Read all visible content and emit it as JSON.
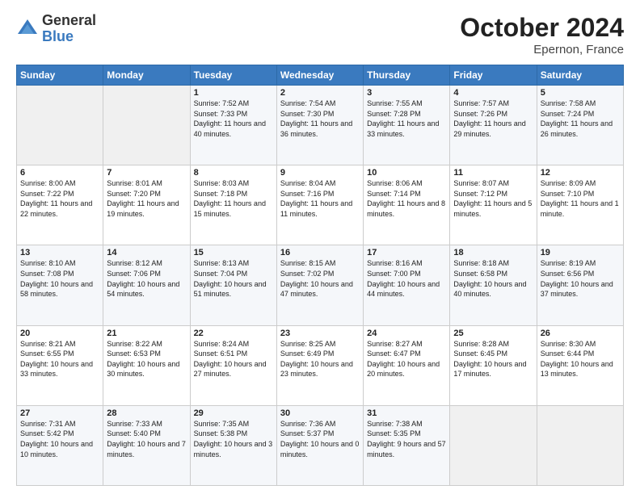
{
  "logo": {
    "general": "General",
    "blue": "Blue"
  },
  "header": {
    "month": "October 2024",
    "location": "Epernon, France"
  },
  "weekdays": [
    "Sunday",
    "Monday",
    "Tuesday",
    "Wednesday",
    "Thursday",
    "Friday",
    "Saturday"
  ],
  "weeks": [
    [
      {
        "day": "",
        "sunrise": "",
        "sunset": "",
        "daylight": ""
      },
      {
        "day": "",
        "sunrise": "",
        "sunset": "",
        "daylight": ""
      },
      {
        "day": "1",
        "sunrise": "Sunrise: 7:52 AM",
        "sunset": "Sunset: 7:33 PM",
        "daylight": "Daylight: 11 hours and 40 minutes."
      },
      {
        "day": "2",
        "sunrise": "Sunrise: 7:54 AM",
        "sunset": "Sunset: 7:30 PM",
        "daylight": "Daylight: 11 hours and 36 minutes."
      },
      {
        "day": "3",
        "sunrise": "Sunrise: 7:55 AM",
        "sunset": "Sunset: 7:28 PM",
        "daylight": "Daylight: 11 hours and 33 minutes."
      },
      {
        "day": "4",
        "sunrise": "Sunrise: 7:57 AM",
        "sunset": "Sunset: 7:26 PM",
        "daylight": "Daylight: 11 hours and 29 minutes."
      },
      {
        "day": "5",
        "sunrise": "Sunrise: 7:58 AM",
        "sunset": "Sunset: 7:24 PM",
        "daylight": "Daylight: 11 hours and 26 minutes."
      }
    ],
    [
      {
        "day": "6",
        "sunrise": "Sunrise: 8:00 AM",
        "sunset": "Sunset: 7:22 PM",
        "daylight": "Daylight: 11 hours and 22 minutes."
      },
      {
        "day": "7",
        "sunrise": "Sunrise: 8:01 AM",
        "sunset": "Sunset: 7:20 PM",
        "daylight": "Daylight: 11 hours and 19 minutes."
      },
      {
        "day": "8",
        "sunrise": "Sunrise: 8:03 AM",
        "sunset": "Sunset: 7:18 PM",
        "daylight": "Daylight: 11 hours and 15 minutes."
      },
      {
        "day": "9",
        "sunrise": "Sunrise: 8:04 AM",
        "sunset": "Sunset: 7:16 PM",
        "daylight": "Daylight: 11 hours and 11 minutes."
      },
      {
        "day": "10",
        "sunrise": "Sunrise: 8:06 AM",
        "sunset": "Sunset: 7:14 PM",
        "daylight": "Daylight: 11 hours and 8 minutes."
      },
      {
        "day": "11",
        "sunrise": "Sunrise: 8:07 AM",
        "sunset": "Sunset: 7:12 PM",
        "daylight": "Daylight: 11 hours and 5 minutes."
      },
      {
        "day": "12",
        "sunrise": "Sunrise: 8:09 AM",
        "sunset": "Sunset: 7:10 PM",
        "daylight": "Daylight: 11 hours and 1 minute."
      }
    ],
    [
      {
        "day": "13",
        "sunrise": "Sunrise: 8:10 AM",
        "sunset": "Sunset: 7:08 PM",
        "daylight": "Daylight: 10 hours and 58 minutes."
      },
      {
        "day": "14",
        "sunrise": "Sunrise: 8:12 AM",
        "sunset": "Sunset: 7:06 PM",
        "daylight": "Daylight: 10 hours and 54 minutes."
      },
      {
        "day": "15",
        "sunrise": "Sunrise: 8:13 AM",
        "sunset": "Sunset: 7:04 PM",
        "daylight": "Daylight: 10 hours and 51 minutes."
      },
      {
        "day": "16",
        "sunrise": "Sunrise: 8:15 AM",
        "sunset": "Sunset: 7:02 PM",
        "daylight": "Daylight: 10 hours and 47 minutes."
      },
      {
        "day": "17",
        "sunrise": "Sunrise: 8:16 AM",
        "sunset": "Sunset: 7:00 PM",
        "daylight": "Daylight: 10 hours and 44 minutes."
      },
      {
        "day": "18",
        "sunrise": "Sunrise: 8:18 AM",
        "sunset": "Sunset: 6:58 PM",
        "daylight": "Daylight: 10 hours and 40 minutes."
      },
      {
        "day": "19",
        "sunrise": "Sunrise: 8:19 AM",
        "sunset": "Sunset: 6:56 PM",
        "daylight": "Daylight: 10 hours and 37 minutes."
      }
    ],
    [
      {
        "day": "20",
        "sunrise": "Sunrise: 8:21 AM",
        "sunset": "Sunset: 6:55 PM",
        "daylight": "Daylight: 10 hours and 33 minutes."
      },
      {
        "day": "21",
        "sunrise": "Sunrise: 8:22 AM",
        "sunset": "Sunset: 6:53 PM",
        "daylight": "Daylight: 10 hours and 30 minutes."
      },
      {
        "day": "22",
        "sunrise": "Sunrise: 8:24 AM",
        "sunset": "Sunset: 6:51 PM",
        "daylight": "Daylight: 10 hours and 27 minutes."
      },
      {
        "day": "23",
        "sunrise": "Sunrise: 8:25 AM",
        "sunset": "Sunset: 6:49 PM",
        "daylight": "Daylight: 10 hours and 23 minutes."
      },
      {
        "day": "24",
        "sunrise": "Sunrise: 8:27 AM",
        "sunset": "Sunset: 6:47 PM",
        "daylight": "Daylight: 10 hours and 20 minutes."
      },
      {
        "day": "25",
        "sunrise": "Sunrise: 8:28 AM",
        "sunset": "Sunset: 6:45 PM",
        "daylight": "Daylight: 10 hours and 17 minutes."
      },
      {
        "day": "26",
        "sunrise": "Sunrise: 8:30 AM",
        "sunset": "Sunset: 6:44 PM",
        "daylight": "Daylight: 10 hours and 13 minutes."
      }
    ],
    [
      {
        "day": "27",
        "sunrise": "Sunrise: 7:31 AM",
        "sunset": "Sunset: 5:42 PM",
        "daylight": "Daylight: 10 hours and 10 minutes."
      },
      {
        "day": "28",
        "sunrise": "Sunrise: 7:33 AM",
        "sunset": "Sunset: 5:40 PM",
        "daylight": "Daylight: 10 hours and 7 minutes."
      },
      {
        "day": "29",
        "sunrise": "Sunrise: 7:35 AM",
        "sunset": "Sunset: 5:38 PM",
        "daylight": "Daylight: 10 hours and 3 minutes."
      },
      {
        "day": "30",
        "sunrise": "Sunrise: 7:36 AM",
        "sunset": "Sunset: 5:37 PM",
        "daylight": "Daylight: 10 hours and 0 minutes."
      },
      {
        "day": "31",
        "sunrise": "Sunrise: 7:38 AM",
        "sunset": "Sunset: 5:35 PM",
        "daylight": "Daylight: 9 hours and 57 minutes."
      },
      {
        "day": "",
        "sunrise": "",
        "sunset": "",
        "daylight": ""
      },
      {
        "day": "",
        "sunrise": "",
        "sunset": "",
        "daylight": ""
      }
    ]
  ]
}
